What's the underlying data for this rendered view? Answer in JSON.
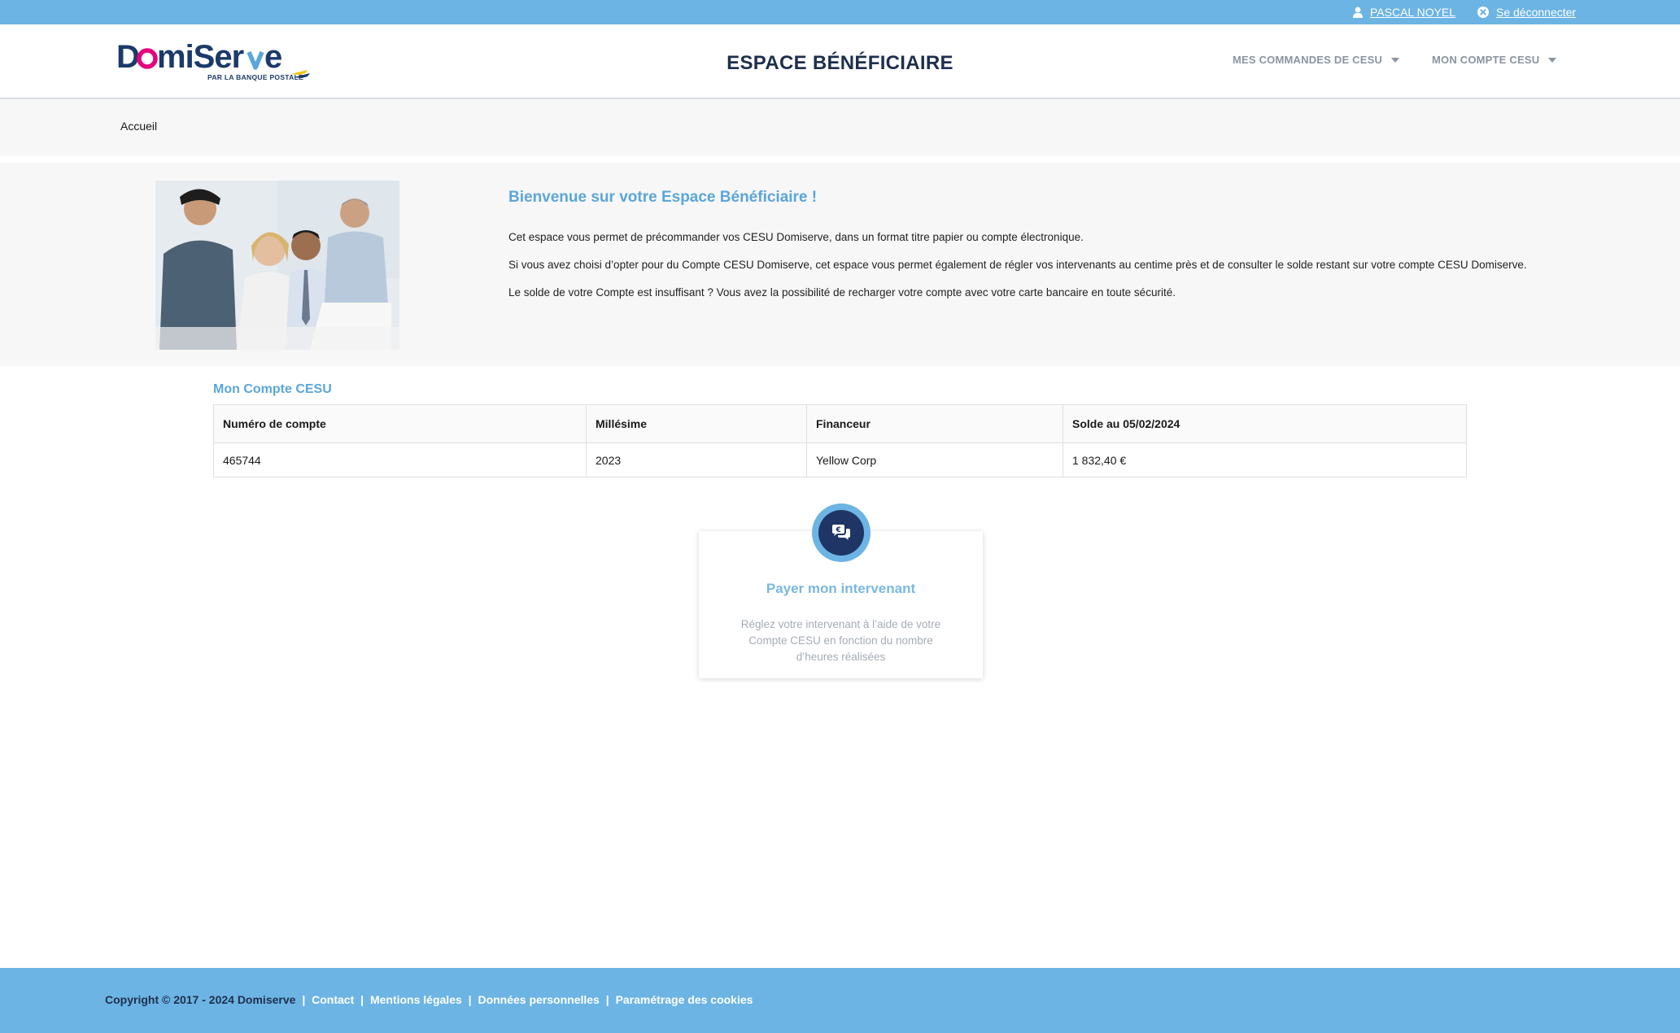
{
  "topbar": {
    "user_name": "PASCAL NOYEL",
    "logout_label": "Se déconnecter"
  },
  "header": {
    "logo_text": "DomiServe",
    "logo_subtitle": "PAR LA BANQUE POSTALE",
    "title": "ESPACE BÉNÉFICIAIRE",
    "nav": [
      {
        "label": "MES COMMANDES DE CESU"
      },
      {
        "label": "MON COMPTE CESU"
      }
    ]
  },
  "breadcrumb": {
    "home": "Accueil"
  },
  "welcome": {
    "heading": "Bienvenue sur votre Espace Bénéficiaire !",
    "paragraphs": [
      "Cet espace vous permet de précommander vos CESU Domiserve, dans un format titre papier ou compte électronique.",
      "Si vous avez choisi d’opter pour du Compte CESU Domiserve, cet espace vous permet également de régler vos intervenants au centime près et de consulter le solde restant sur votre compte CESU Domiserve.",
      "Le solde de votre Compte est insuffisant ? Vous avez la possibilité de recharger votre compte avec votre carte bancaire en toute sécurité."
    ]
  },
  "account": {
    "title": "Mon Compte CESU",
    "columns": [
      "Numéro de compte",
      "Millésime",
      "Financeur",
      "Solde au 05/02/2024"
    ],
    "rows": [
      [
        "465744",
        "2023",
        "Yellow Corp",
        "1 832,40 €"
      ]
    ]
  },
  "pay_card": {
    "icon": "chat-bubbles-euro-icon",
    "title": "Payer mon intervenant",
    "description": "Réglez votre intervenant à l’aide de votre Compte CESU en fonction du nombre d’heures réalisées"
  },
  "footer": {
    "copyright": "Copyright © 2017 - 2024 Domiserve",
    "links": [
      "Contact",
      "Mentions légales",
      "Données personnelles",
      "Paramétrage des cookies"
    ]
  },
  "colors": {
    "accent": "#6cb4e4",
    "heading_blue": "#5aa6db",
    "navy": "#1e3566",
    "band_gray": "#f7f7f7"
  }
}
